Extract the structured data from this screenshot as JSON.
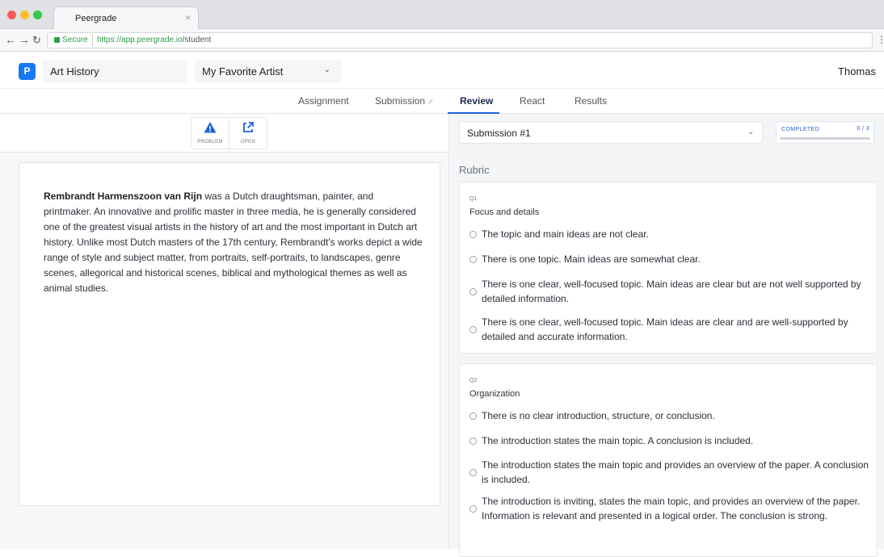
{
  "browser": {
    "tab_title": "Peergrade",
    "tab_close": "×",
    "secure_label": "Secure",
    "url_host": "https://app.peergrade.io",
    "url_path": "/student"
  },
  "header": {
    "logo_letter": "P",
    "course": "Art History",
    "assignment": "My Favorite Artist",
    "user": "Thomas"
  },
  "tabs": [
    {
      "label": "Assignment",
      "done": false
    },
    {
      "label": "Submission",
      "done": true
    },
    {
      "label": "Review",
      "active": true
    },
    {
      "label": "React"
    },
    {
      "label": "Results"
    }
  ],
  "tab_check": "✓",
  "toolbar": {
    "problem_label": "PROBLEM",
    "open_label": "OPEN"
  },
  "document": {
    "bold_name": "Rembrandt Harmenszoon van Rijn",
    "body": " was a Dutch draughtsman, painter, and printmaker. An innovative and prolific master in three media, he is generally considered one of the greatest visual artists in the history of art and the most important in Dutch art history. Unlike most Dutch masters of the 17th century, Rembrandt's works depict a wide range of style and subject matter, from portraits, self-portraits, to landscapes, genre scenes, allegorical and historical scenes, biblical and mythological themes as well as animal studies."
  },
  "review": {
    "submission_select": "Submission #1",
    "completed_label": "COMPLETED",
    "completed_value": "0 / 3",
    "completed_fraction": 0,
    "rubric_title": "Rubric",
    "questions": [
      {
        "num": "Q1",
        "title": "Focus and details",
        "options": [
          "The topic and main ideas are not clear.",
          "There is one topic. Main ideas are somewhat clear.",
          "There is one clear, well-focused topic. Main ideas are clear but are not well supported by detailed information.",
          "There is one clear, well-focused topic. Main ideas are clear and are well-supported by detailed and accurate information."
        ]
      },
      {
        "num": "Q2",
        "title": "Organization",
        "options": [
          "There is no clear introduction, structure, or conclusion.",
          "The introduction states the main topic. A conclusion is included.",
          "The introduction states the main topic and provides an overview of the paper. A conclusion is included.",
          "The introduction is inviting, states the main topic, and provides an overview of the paper. Information is relevant and presented in a logical order. The conclusion is strong."
        ]
      }
    ]
  },
  "colors": {
    "accent": "#1f63d6",
    "logo": "#1877f2",
    "secure": "#2e9c43",
    "check": "#7ed083"
  }
}
